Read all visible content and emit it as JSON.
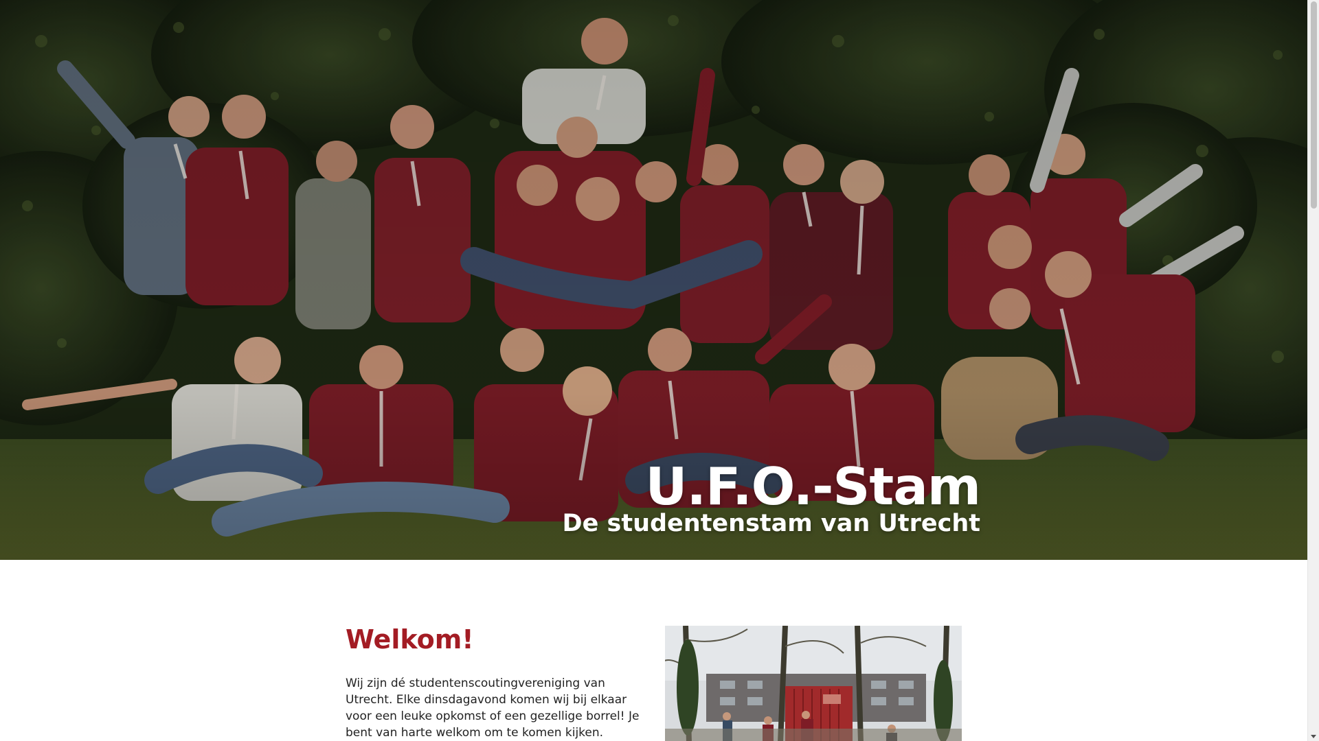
{
  "hero": {
    "title": "U.F.O.-Stam",
    "subtitle": "De studentenstam van Utrecht",
    "image": "group-photo-scouts-in-red-uniforms",
    "overlay_color": "#000000"
  },
  "welcome": {
    "heading": "Welkom!",
    "text": "Wij zijn dé studentenscoutingvereniging van Utrecht. Elke dinsdagavond komen wij bij elkaar voor een leuke opkomst of een gezellige borrel! Je bent van harte welkom om te komen kijken.",
    "image": "scouts-at-red-shipping-container-in-forest"
  },
  "colors": {
    "accent": "#a31c24",
    "body_text": "#222222",
    "uniform_red": "#7e1c26"
  },
  "scrollbar": {
    "thumb_icon": "scroll-thumb",
    "arrow_icon": "chevron-down-icon"
  }
}
